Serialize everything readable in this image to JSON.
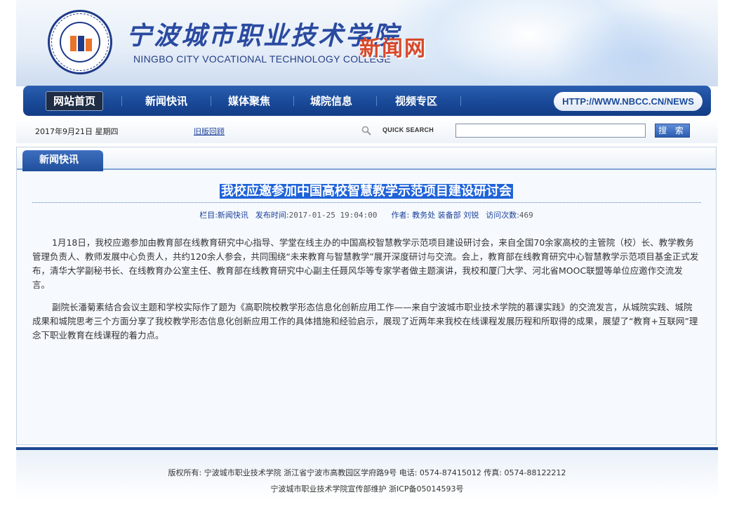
{
  "header": {
    "college_cn": "宁波城市职业技术学院",
    "college_en": "NINGBO CITY VOCATIONAL TECHNOLOGY COLLEGE",
    "site_name": "新闻网",
    "logo_icon": "college-seal-icon"
  },
  "nav": {
    "items": [
      {
        "label": "网站首页",
        "active": true
      },
      {
        "label": "新闻快讯",
        "active": false
      },
      {
        "label": "媒体聚焦",
        "active": false
      },
      {
        "label": "城院信息",
        "active": false
      },
      {
        "label": "视频专区",
        "active": false
      }
    ],
    "url": "HTTP://WWW.NBCC.CN/NEWS"
  },
  "utility": {
    "date": "2017年9月21日 星期四",
    "old_version_link": "旧版回顾",
    "quick_search_label": "QUICK SEARCH",
    "search_value": "",
    "search_button": "搜 索"
  },
  "panel": {
    "tab_label": "新闻快讯"
  },
  "article": {
    "title": "我校应邀参加中国高校智慧教学示范项目建设研讨会",
    "meta": {
      "column_label": "栏目:",
      "column_value": "新闻快讯",
      "time_label": "发布时间:",
      "time_value": "2017-01-25 19:04:00",
      "author_label": "作者:",
      "author_value": "教务处 装备部 刘锐",
      "views_label": "访问次数:",
      "views_value": "469"
    },
    "paragraphs": [
      "1月18日，我校应邀参加由教育部在线教育研究中心指导、学堂在线主办的中国高校智慧教学示范项目建设研讨会，来自全国70余家高校的主管院（校）长、教学教务管理负责人、教师发展中心负责人，共约120余人参会，共同围绕“未来教育与智慧教学”展开深度研讨与交流。会上，教育部在线教育研究中心智慧教学示范项目基金正式发布，清华大学副秘书长、在线教育办公室主任、教育部在线教育研究中心副主任聂风华等专家学者做主题演讲，我校和厦门大学、河北省MOOC联盟等单位应邀作交流发言。",
      "副院长潘菊素结合会议主题和学校实际作了题为《高职院校教学形态信息化创新应用工作——来自宁波城市职业技术学院的慕课实践》的交流发言，从城院实践、城院成果和城院思考三个方面分享了我校教学形态信息化创新应用工作的具体措施和经验启示，展现了近两年来我校在线课程发展历程和所取得的成果，展望了“教育+互联网”理念下职业教育在线课程的着力点。"
    ]
  },
  "footer": {
    "line1": "版权所有: 宁波城市职业技术学院 浙江省宁波市高教园区学府路9号 电话: 0574-87415012 传真: 0574-88122212",
    "line2": "宁波城市职业技术学院宣传部维护 浙ICP备05014593号"
  },
  "colors": {
    "nav_blue": "#1a4b9a",
    "title_highlight": "#1f63d8",
    "site_name_red": "#d8492a"
  }
}
